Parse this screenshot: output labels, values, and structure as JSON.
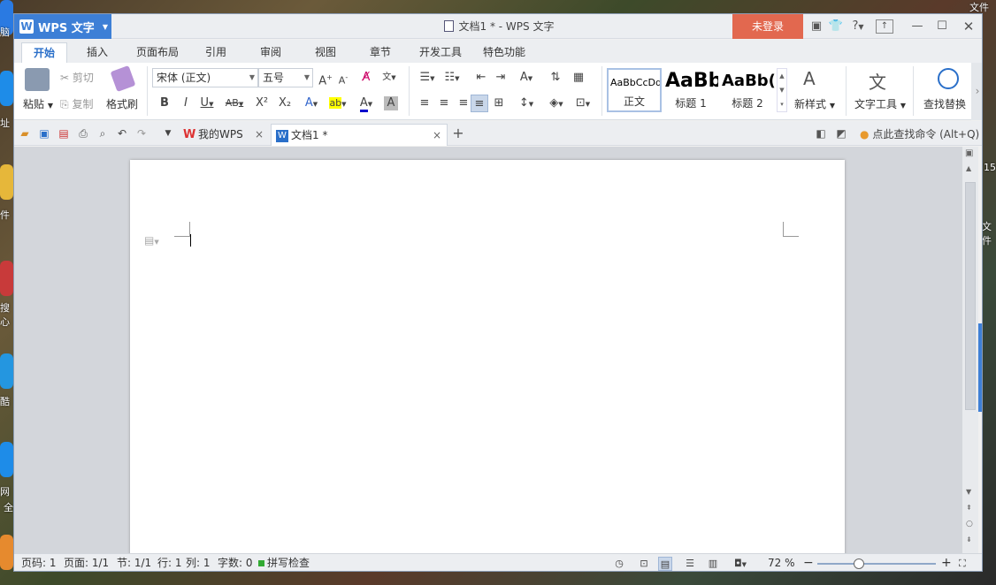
{
  "app": {
    "name": "WPS 文字",
    "window_title": "文档1 * - WPS 文字",
    "login_label": "未登录",
    "help_label": "?"
  },
  "ribbon_tabs": [
    "开始",
    "插入",
    "页面布局",
    "引用",
    "审阅",
    "视图",
    "章节",
    "开发工具",
    "特色功能"
  ],
  "ribbon": {
    "paste": "粘贴",
    "cut": "剪切",
    "copy": "复制",
    "format_painter": "格式刷",
    "font_name": "宋体 (正文)",
    "font_size": "五号",
    "styles": [
      {
        "sample": "AaBbCcDd",
        "label": "正文"
      },
      {
        "sample": "AaBb",
        "label": "标题 1"
      },
      {
        "sample": "AaBb(",
        "label": "标题 2"
      }
    ],
    "new_style": "新样式",
    "text_tools": "文字工具",
    "find_replace": "查找替换"
  },
  "doc_tabs": [
    {
      "label": "我的WPS"
    },
    {
      "label": "文档1 *"
    }
  ],
  "search_hint": "点此查找命令 (Alt+Q)",
  "status": {
    "page_no": "页码: 1",
    "pages": "页面: 1/1",
    "section": "节: 1/1",
    "row": "行: 1",
    "col": "列: 1",
    "words": "字数: 0",
    "spell": "拼写检查",
    "zoom": "72 %"
  },
  "zoom_level": 0.72,
  "desktop_labels": [
    "脑",
    "址",
    "件",
    "搜",
    "心",
    "酷",
    "网",
    "全",
    "文件",
    "15",
    "文件"
  ],
  "colors": {
    "accent": "#3d7fd6",
    "login": "#e2684f",
    "font_color": "#0000cc",
    "highlight": "#ffff00"
  }
}
